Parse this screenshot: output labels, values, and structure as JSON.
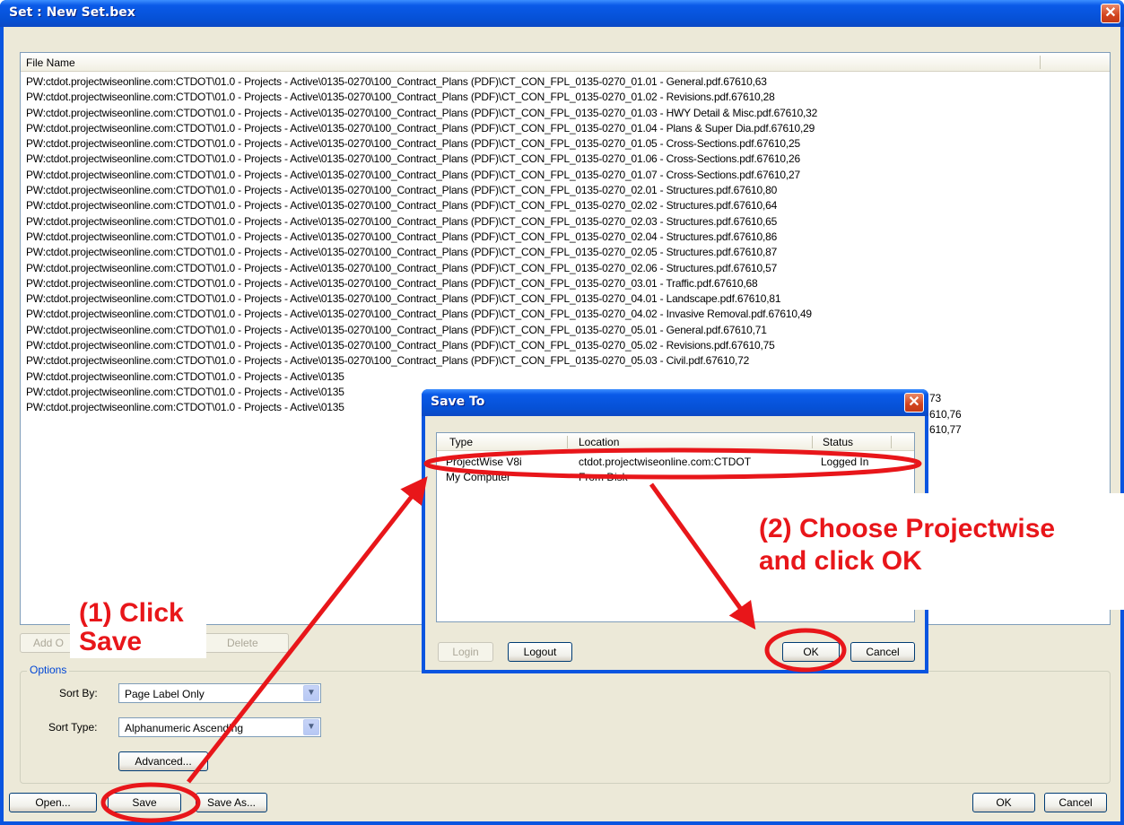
{
  "main_window": {
    "title": "Set : New Set.bex",
    "close_glyph": "✕",
    "file_list": {
      "header": "File Name",
      "rows": [
        "PW:ctdot.projectwiseonline.com:CTDOT\\01.0 - Projects - Active\\0135-0270\\100_Contract_Plans (PDF)\\CT_CON_FPL_0135-0270_01.01 - General.pdf.67610,63",
        "PW:ctdot.projectwiseonline.com:CTDOT\\01.0 - Projects - Active\\0135-0270\\100_Contract_Plans (PDF)\\CT_CON_FPL_0135-0270_01.02 - Revisions.pdf.67610,28",
        "PW:ctdot.projectwiseonline.com:CTDOT\\01.0 - Projects - Active\\0135-0270\\100_Contract_Plans (PDF)\\CT_CON_FPL_0135-0270_01.03 - HWY Detail & Misc.pdf.67610,32",
        "PW:ctdot.projectwiseonline.com:CTDOT\\01.0 - Projects - Active\\0135-0270\\100_Contract_Plans (PDF)\\CT_CON_FPL_0135-0270_01.04 - Plans & Super Dia.pdf.67610,29",
        "PW:ctdot.projectwiseonline.com:CTDOT\\01.0 - Projects - Active\\0135-0270\\100_Contract_Plans (PDF)\\CT_CON_FPL_0135-0270_01.05 - Cross-Sections.pdf.67610,25",
        "PW:ctdot.projectwiseonline.com:CTDOT\\01.0 - Projects - Active\\0135-0270\\100_Contract_Plans (PDF)\\CT_CON_FPL_0135-0270_01.06 - Cross-Sections.pdf.67610,26",
        "PW:ctdot.projectwiseonline.com:CTDOT\\01.0 - Projects - Active\\0135-0270\\100_Contract_Plans (PDF)\\CT_CON_FPL_0135-0270_01.07 - Cross-Sections.pdf.67610,27",
        "PW:ctdot.projectwiseonline.com:CTDOT\\01.0 - Projects - Active\\0135-0270\\100_Contract_Plans (PDF)\\CT_CON_FPL_0135-0270_02.01 - Structures.pdf.67610,80",
        "PW:ctdot.projectwiseonline.com:CTDOT\\01.0 - Projects - Active\\0135-0270\\100_Contract_Plans (PDF)\\CT_CON_FPL_0135-0270_02.02 - Structures.pdf.67610,64",
        "PW:ctdot.projectwiseonline.com:CTDOT\\01.0 - Projects - Active\\0135-0270\\100_Contract_Plans (PDF)\\CT_CON_FPL_0135-0270_02.03 - Structures.pdf.67610,65",
        "PW:ctdot.projectwiseonline.com:CTDOT\\01.0 - Projects - Active\\0135-0270\\100_Contract_Plans (PDF)\\CT_CON_FPL_0135-0270_02.04 - Structures.pdf.67610,86",
        "PW:ctdot.projectwiseonline.com:CTDOT\\01.0 - Projects - Active\\0135-0270\\100_Contract_Plans (PDF)\\CT_CON_FPL_0135-0270_02.05 - Structures.pdf.67610,87",
        "PW:ctdot.projectwiseonline.com:CTDOT\\01.0 - Projects - Active\\0135-0270\\100_Contract_Plans (PDF)\\CT_CON_FPL_0135-0270_02.06 - Structures.pdf.67610,57",
        "PW:ctdot.projectwiseonline.com:CTDOT\\01.0 - Projects - Active\\0135-0270\\100_Contract_Plans (PDF)\\CT_CON_FPL_0135-0270_03.01 - Traffic.pdf.67610,68",
        "PW:ctdot.projectwiseonline.com:CTDOT\\01.0 - Projects - Active\\0135-0270\\100_Contract_Plans (PDF)\\CT_CON_FPL_0135-0270_04.01 - Landscape.pdf.67610,81",
        "PW:ctdot.projectwiseonline.com:CTDOT\\01.0 - Projects - Active\\0135-0270\\100_Contract_Plans (PDF)\\CT_CON_FPL_0135-0270_04.02 - Invasive Removal.pdf.67610,49",
        "PW:ctdot.projectwiseonline.com:CTDOT\\01.0 - Projects - Active\\0135-0270\\100_Contract_Plans (PDF)\\CT_CON_FPL_0135-0270_05.01 - General.pdf.67610,71",
        "PW:ctdot.projectwiseonline.com:CTDOT\\01.0 - Projects - Active\\0135-0270\\100_Contract_Plans (PDF)\\CT_CON_FPL_0135-0270_05.02 - Revisions.pdf.67610,75",
        "PW:ctdot.projectwiseonline.com:CTDOT\\01.0 - Projects - Active\\0135-0270\\100_Contract_Plans (PDF)\\CT_CON_FPL_0135-0270_05.03 - Civil.pdf.67610,72",
        "PW:ctdot.projectwiseonline.com:CTDOT\\01.0 - Projects - Active\\0135",
        "PW:ctdot.projectwiseonline.com:CTDOT\\01.0 - Projects - Active\\0135",
        "PW:ctdot.projectwiseonline.com:CTDOT\\01.0 - Projects - Active\\0135"
      ],
      "row_tails": [
        "73",
        "610,76",
        "610,77"
      ]
    },
    "list_buttons": {
      "add": "Add O",
      "delete": "Delete"
    },
    "options": {
      "legend": "Options",
      "sort_by_label": "Sort By:",
      "sort_by_value": "Page Label Only",
      "sort_type_label": "Sort Type:",
      "sort_type_value": "Alphanumeric Ascending",
      "advanced": "Advanced..."
    },
    "footer": {
      "open": "Open...",
      "save": "Save",
      "save_as": "Save As...",
      "ok": "OK",
      "cancel": "Cancel"
    }
  },
  "save_to_dialog": {
    "title": "Save To",
    "close_glyph": "✕",
    "columns": [
      "Type",
      "Location",
      "Status"
    ],
    "rows": [
      {
        "type": "ProjectWise V8i",
        "location": "ctdot.projectwiseonline.com:CTDOT",
        "status": "Logged In"
      },
      {
        "type": "My Computer",
        "location": "From Disk",
        "status": ""
      }
    ],
    "buttons": {
      "login": "Login",
      "logout": "Logout",
      "ok": "OK",
      "cancel": "Cancel"
    }
  },
  "annotations": {
    "step1": [
      "(1) Click",
      "Save"
    ],
    "step2": [
      "(2) Choose Projectwise",
      "and click OK"
    ],
    "color": "#e8161a"
  },
  "colors": {
    "titlebar": "#0651d6",
    "dialog_face": "#ece9d8",
    "annotation_red": "#e8161a"
  }
}
